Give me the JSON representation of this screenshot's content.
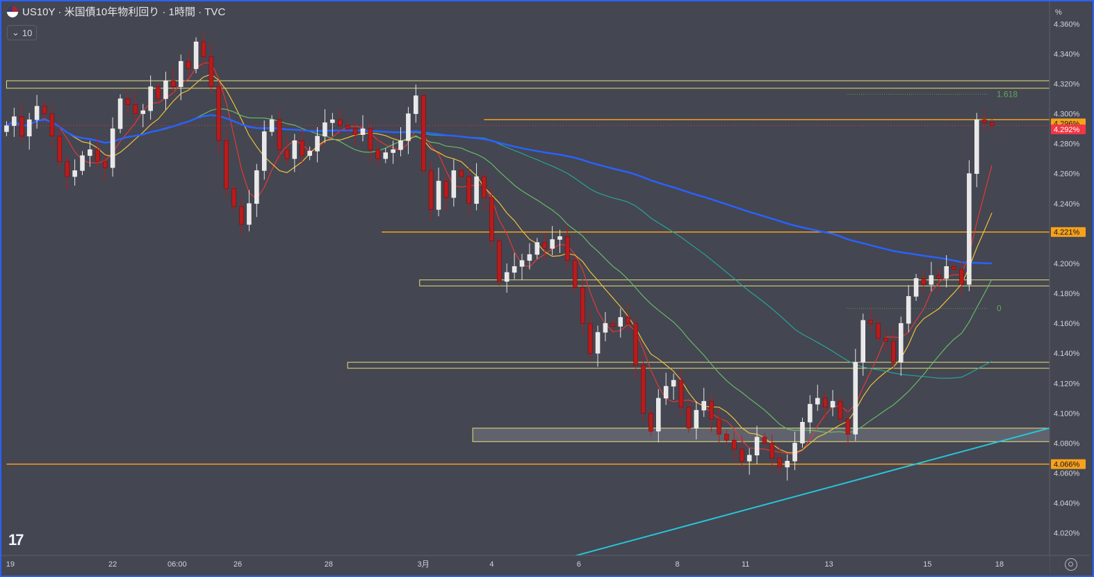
{
  "header": {
    "title": "US10Y · 米国債10年物利回り · 1時間 · TVC",
    "interval_label": "10",
    "scale_unit": "%"
  },
  "colors": {
    "background": "#444651",
    "frame": "#2962ff",
    "candle_up": "#e8e8e8",
    "candle_down": "#b71c1c",
    "ma_red": "#e53935",
    "ma_yellow": "#f0c23b",
    "ma_green": "#66bb6a",
    "ma_teal": "#26a69a",
    "ma_blue": "#2962ff",
    "trend_line": "#26c6da",
    "level_orange": "#f7a21b",
    "zone_yellow": "#e8e07a",
    "fib": "#5c9a4e",
    "price_label_red": "#f23645"
  },
  "chart_data": {
    "type": "candlestick",
    "symbol": "US10Y",
    "timeframe": "1時間",
    "ylim": [
      4.005,
      4.375
    ],
    "y_ticks": [
      "4.360%",
      "4.340%",
      "4.320%",
      "4.300%",
      "4.280%",
      "4.260%",
      "4.240%",
      "4.220%",
      "4.200%",
      "4.180%",
      "4.160%",
      "4.140%",
      "4.120%",
      "4.100%",
      "4.080%",
      "4.060%",
      "4.040%",
      "4.020%"
    ],
    "y_tick_values": [
      4.36,
      4.34,
      4.32,
      4.3,
      4.28,
      4.26,
      4.24,
      4.22,
      4.2,
      4.18,
      4.16,
      4.14,
      4.12,
      4.1,
      4.08,
      4.06,
      4.04,
      4.02
    ],
    "x_ticks": [
      {
        "label": "19",
        "t": 0.5
      },
      {
        "label": "22",
        "t": 14
      },
      {
        "label": "06:00",
        "t": 22.5
      },
      {
        "label": "26",
        "t": 30.5
      },
      {
        "label": "28",
        "t": 42.5
      },
      {
        "label": "3月",
        "t": 55
      },
      {
        "label": "4",
        "t": 64
      },
      {
        "label": "6",
        "t": 75.5
      },
      {
        "label": "8",
        "t": 88.5
      },
      {
        "label": "11",
        "t": 97.5
      },
      {
        "label": "13",
        "t": 108.5
      },
      {
        "label": "15",
        "t": 121.5
      },
      {
        "label": "18",
        "t": 131
      }
    ],
    "closes": [
      4.292,
      4.298,
      4.285,
      4.296,
      4.305,
      4.3,
      4.285,
      4.268,
      4.258,
      4.262,
      4.272,
      4.276,
      4.268,
      4.264,
      4.29,
      4.31,
      4.306,
      4.3,
      4.302,
      4.318,
      4.31,
      4.322,
      4.318,
      4.335,
      4.33,
      4.348,
      4.338,
      4.318,
      4.282,
      4.25,
      4.238,
      4.226,
      4.24,
      4.262,
      4.288,
      4.296,
      4.276,
      4.27,
      4.282,
      4.272,
      4.275,
      4.285,
      4.294,
      4.296,
      4.292,
      4.29,
      4.286,
      4.29,
      4.276,
      4.27,
      4.274,
      4.276,
      4.282,
      4.3,
      4.312,
      4.262,
      4.236,
      4.255,
      4.244,
      4.262,
      4.258,
      4.24,
      4.258,
      4.244,
      4.215,
      4.188,
      4.194,
      4.198,
      4.202,
      4.206,
      4.214,
      4.21,
      4.216,
      4.218,
      4.202,
      4.184,
      4.16,
      4.14,
      4.154,
      4.16,
      4.158,
      4.164,
      4.16,
      4.132,
      4.1,
      4.088,
      4.11,
      4.118,
      4.122,
      4.104,
      4.09,
      4.102,
      4.108,
      4.096,
      4.086,
      4.082,
      4.076,
      4.068,
      4.072,
      4.084,
      4.08,
      4.07,
      4.064,
      4.068,
      4.08,
      4.094,
      4.106,
      4.11,
      4.104,
      4.108,
      4.096,
      4.086,
      4.134,
      4.162,
      4.16,
      4.15,
      4.148,
      4.134,
      4.16,
      4.178,
      4.19,
      4.186,
      4.192,
      4.19,
      4.198,
      4.196,
      4.186,
      4.26,
      4.296,
      4.294,
      4.292
    ],
    "moving_averages": [
      {
        "color": "#e53935",
        "period": 5
      },
      {
        "color": "#f0c23b",
        "period": 9
      },
      {
        "color": "#66bb6a",
        "period": 20
      },
      {
        "color": "#26a69a",
        "period": 50
      },
      {
        "color": "#2962ff",
        "period": 110
      }
    ],
    "horizontal_levels": [
      {
        "value": 4.296,
        "label": "4.296%",
        "start_t": 63,
        "color": "#f7a21b"
      },
      {
        "value": 4.221,
        "label": "4.221%",
        "start_t": 49.5,
        "color": "#f7a21b"
      },
      {
        "value": 4.066,
        "label": "4.066%",
        "start_t": 0,
        "color": "#f7a21b"
      }
    ],
    "current_price": {
      "value": 4.292,
      "label": "4.292%"
    },
    "zones": [
      {
        "low": 4.317,
        "high": 4.322,
        "start_t": 0
      },
      {
        "low": 4.185,
        "high": 4.189,
        "start_t": 54.5
      },
      {
        "low": 4.13,
        "high": 4.134,
        "start_t": 45
      },
      {
        "low": 4.081,
        "high": 4.09,
        "start_t": 61.5
      }
    ],
    "fib_levels": [
      {
        "label": "1.618",
        "value": 4.313
      },
      {
        "label": "0",
        "value": 4.17
      }
    ],
    "trend_line": {
      "start": [
        71.5,
        4.0
      ],
      "end": [
        139,
        4.092
      ]
    }
  },
  "branding": {
    "logo_text": "17"
  }
}
